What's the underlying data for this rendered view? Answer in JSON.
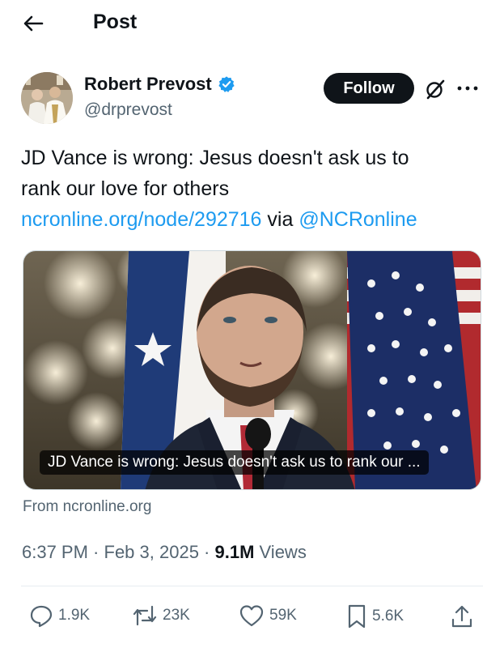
{
  "header": {
    "title": "Post",
    "back_icon": "arrow-left-icon"
  },
  "author": {
    "display_name": "Robert Prevost",
    "handle": "@drprevost",
    "verified_badge": "verified-badge-icon",
    "follow_label": "Follow"
  },
  "tweet": {
    "text_line1": "JD Vance is wrong: Jesus doesn't ask us to",
    "text_line2": "rank our love for others",
    "link_url": "ncronline.org/node/292716",
    "via_text": " via ",
    "via_handle": "@NCRonline"
  },
  "card": {
    "caption": "JD Vance is wrong: Jesus doesn't ask us to rank our ...",
    "source": "From ncronline.org"
  },
  "meta": {
    "time": "6:37 PM",
    "separator": " · ",
    "date": "Feb 3, 2025",
    "views_count": "9.1M",
    "views_label": " Views"
  },
  "actions": {
    "replies": "1.9K",
    "reposts": "23K",
    "likes": "59K",
    "bookmarks": "5.6K"
  },
  "colors": {
    "link": "#1d9bf0",
    "secondary_text": "#536471",
    "primary_text": "#0f1419",
    "follow_bg": "#0f1419"
  }
}
